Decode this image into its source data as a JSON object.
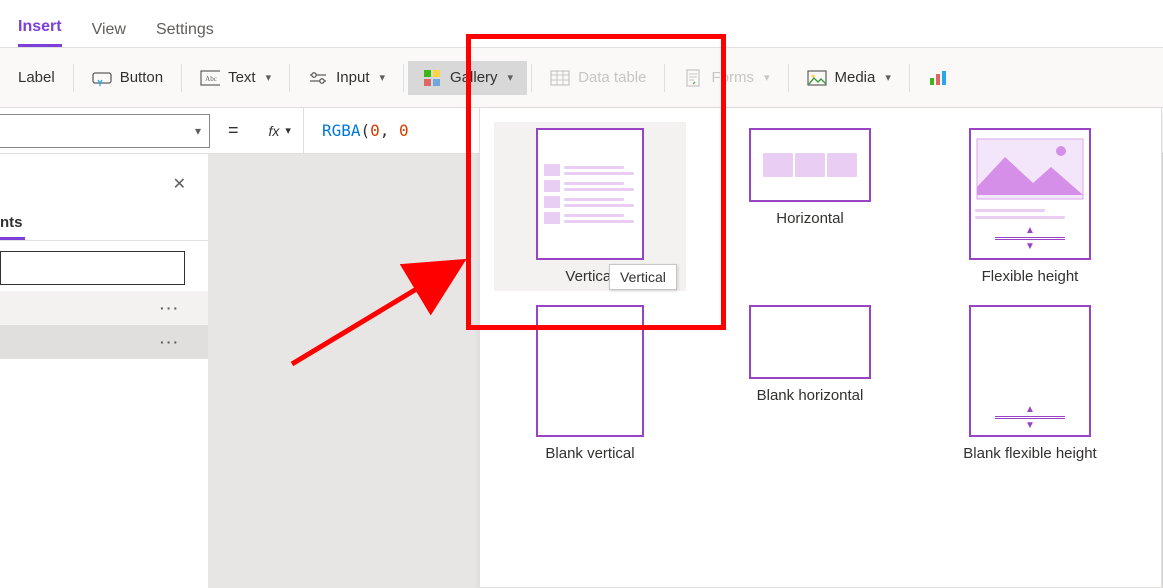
{
  "tabs": {
    "insert": "Insert",
    "view": "View",
    "settings": "Settings"
  },
  "ribbon": {
    "label": "Label",
    "button": "Button",
    "text": "Text",
    "input": "Input",
    "gallery": "Gallery",
    "data_table": "Data table",
    "forms": "Forms",
    "media": "Media"
  },
  "formula": {
    "fx": "fx",
    "equals": "=",
    "fn": "RGBA",
    "open": "(",
    "arg0": "0",
    "comma": ",",
    "arg1_partial": "0"
  },
  "left_pane": {
    "tab_partial": "nts",
    "close_icon": "✕"
  },
  "gallery_panel": {
    "items": [
      {
        "label": "Vertical"
      },
      {
        "label": "Horizontal"
      },
      {
        "label": "Flexible height"
      },
      {
        "label": "Blank vertical"
      },
      {
        "label": "Blank horizontal"
      },
      {
        "label": "Blank flexible height"
      }
    ],
    "tooltip": "Vertical"
  },
  "icons": {
    "label": "label-tag-icon",
    "button": "button-icon",
    "text": "text-abc-icon",
    "input": "input-slider-icon",
    "gallery": "gallery-grid-icon",
    "data_table": "table-icon",
    "forms": "form-icon",
    "media": "image-icon",
    "chart": "chart-icon"
  }
}
